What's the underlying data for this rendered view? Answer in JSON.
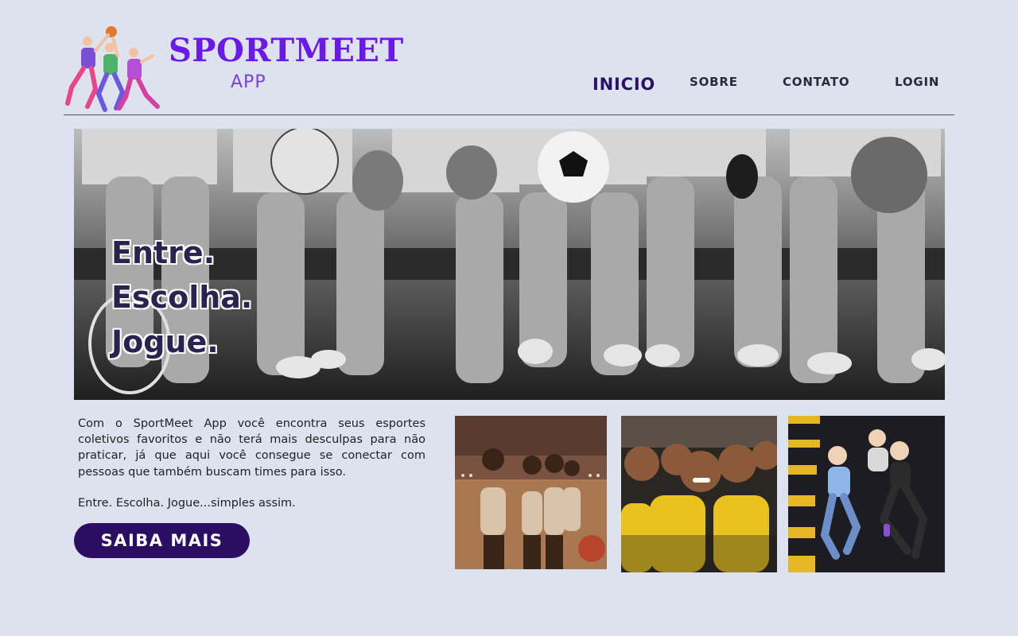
{
  "brand": {
    "title": "SPORTMEET",
    "subtitle": "APP"
  },
  "nav": {
    "items": [
      "INICIO",
      "SOBRE",
      "CONTATO",
      "LOGIN"
    ],
    "active": "INICIO"
  },
  "hero": {
    "lines": [
      "Entre.",
      "Escolha.",
      "Jogue."
    ]
  },
  "content": {
    "description": "Com o SportMeet App você encontra seus esportes coletivos favoritos e não terá mais desculpas para não praticar, já que aqui você consegue se conectar com pessoas que também buscam times para isso.",
    "tagline": "Entre. Escolha. Jogue...simples assim.",
    "cta_label": "SAIBA MAIS"
  },
  "colors": {
    "background": "#dde2ef",
    "brand_purple": "#6a19e6",
    "nav_active": "#2b1067",
    "cta_bg": "#2b0d63"
  },
  "images": {
    "logo": "players-illustration",
    "hero": "athletes-sitting-with-balls-photo",
    "gallery": [
      "bowling-alley-photo",
      "team-celebration-photo",
      "fitness-group-photo"
    ]
  }
}
